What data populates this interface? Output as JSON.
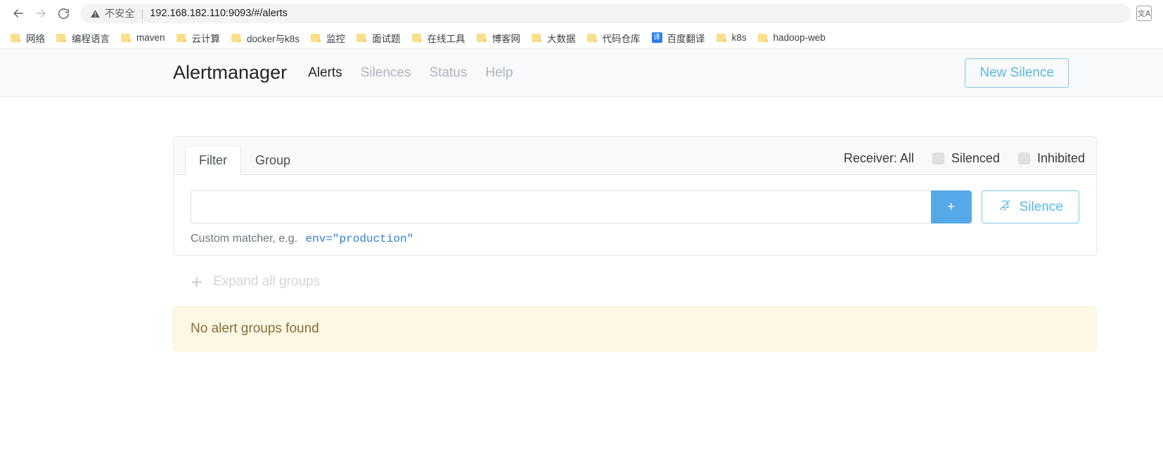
{
  "browser": {
    "back_icon": "arrow-left-icon",
    "forward_icon": "arrow-right-icon",
    "reload_icon": "reload-icon",
    "security_icon": "warning-triangle-icon",
    "security_text": "不安全",
    "separator": "|",
    "url": "192.168.182.110:9093/#/alerts",
    "url_host": "192.168.182.110:9093",
    "url_path": "/#/alerts",
    "translate_icon": "translate-icon",
    "translate_glyph": "文A"
  },
  "bookmarks": [
    {
      "label": "网络",
      "icon": "folder-icon"
    },
    {
      "label": "编程语言",
      "icon": "folder-icon"
    },
    {
      "label": "maven",
      "icon": "folder-icon"
    },
    {
      "label": "云计算",
      "icon": "folder-icon"
    },
    {
      "label": "docker与k8s",
      "icon": "folder-icon"
    },
    {
      "label": "监控",
      "icon": "folder-icon"
    },
    {
      "label": "面试题",
      "icon": "folder-icon"
    },
    {
      "label": "在线工具",
      "icon": "folder-icon"
    },
    {
      "label": "博客网",
      "icon": "folder-icon"
    },
    {
      "label": "大数据",
      "icon": "folder-icon"
    },
    {
      "label": "代码仓库",
      "icon": "folder-icon"
    },
    {
      "label": "百度翻译",
      "icon": "translate-favicon",
      "favicon_glyph": "译"
    },
    {
      "label": "k8s",
      "icon": "folder-icon"
    },
    {
      "label": "hadoop-web",
      "icon": "folder-icon"
    }
  ],
  "navbar": {
    "brand": "Alertmanager",
    "links": [
      {
        "label": "Alerts",
        "active": true
      },
      {
        "label": "Silences",
        "active": false
      },
      {
        "label": "Status",
        "active": false
      },
      {
        "label": "Help",
        "active": false
      }
    ],
    "new_silence_label": "New Silence"
  },
  "filter_card": {
    "tabs": [
      {
        "label": "Filter",
        "active": true
      },
      {
        "label": "Group",
        "active": false
      }
    ],
    "receiver_label": "Receiver: All",
    "checkboxes": [
      {
        "label": "Silenced",
        "checked": false
      },
      {
        "label": "Inhibited",
        "checked": false
      }
    ],
    "matcher_input_value": "",
    "matcher_input_placeholder": "",
    "add_button_label": "+",
    "silence_button_label": "Silence",
    "silence_button_icon": "bell-slash-icon",
    "helper_prefix": "Custom matcher, e.g.",
    "helper_code": "env=\"production\""
  },
  "groups": {
    "expand_icon": "plus-icon",
    "expand_label": "Expand all groups",
    "empty_message": "No alert groups found"
  },
  "colors": {
    "accent_blue": "#56a9e8",
    "outline_blue": "#7cc8ec",
    "link_blue": "#2e7fd4",
    "alert_bg": "#fcf8e3",
    "alert_text": "#8a6d3b",
    "folder_yellow": "#fbe08c",
    "muted": "#adb5bd"
  }
}
